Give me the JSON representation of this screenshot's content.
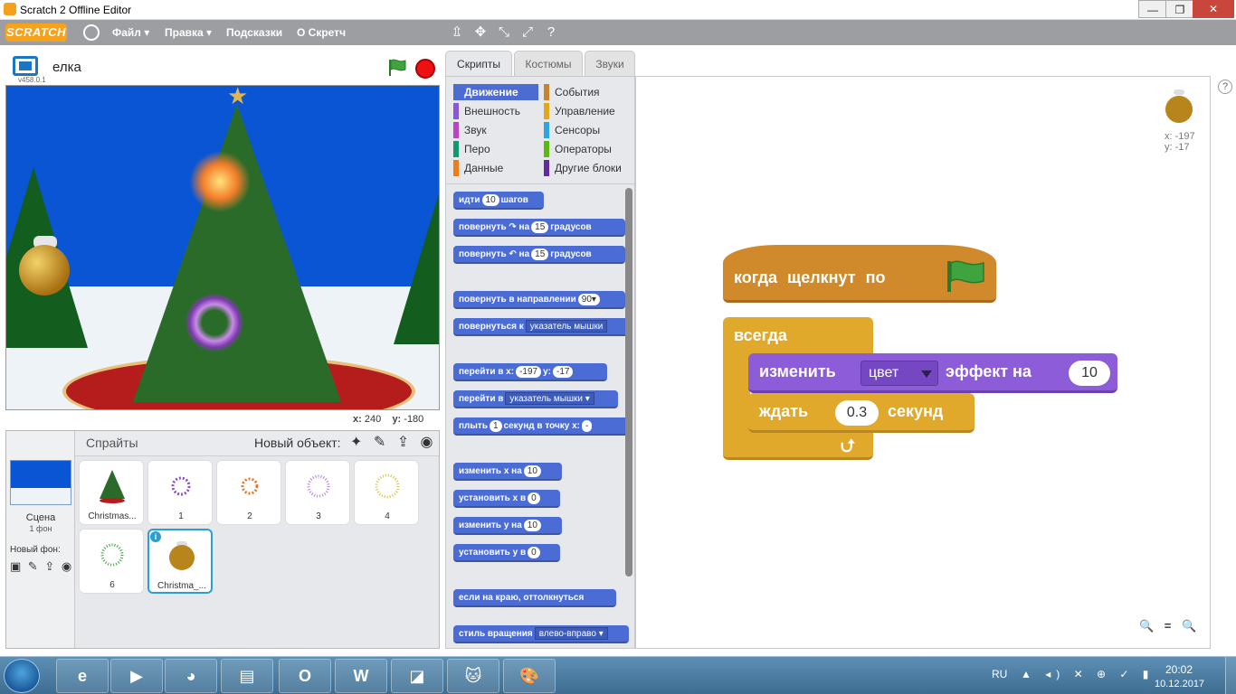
{
  "window": {
    "title": "Scratch 2 Offline Editor",
    "min": "—",
    "max": "❐",
    "close": "✕"
  },
  "menu": {
    "logo": "SCRATCH",
    "items": [
      "Файл ▾",
      "Правка ▾",
      "Подсказки",
      "О Скретч"
    ],
    "tools": [
      "⇫",
      "✥",
      "⤡",
      "⤢",
      "?"
    ]
  },
  "stage": {
    "project_name": "елка",
    "version": "v458.0.1",
    "mouse_x_label": "x:",
    "mouse_x": "240",
    "mouse_y_label": "y:",
    "mouse_y": "-180"
  },
  "sprites_panel": {
    "scene_label": "Сцена",
    "scene_sub": "1 фон",
    "new_backdrop_label": "Новый фон:",
    "new_backdrop_icons": "▣ ✎ ⇪ ◉",
    "title": "Спрайты",
    "new_object_label": "Новый объект:",
    "new_object_icons": "✦ ✎ ⇪ ◉",
    "sprites": [
      {
        "name": "Christmas..."
      },
      {
        "name": "1"
      },
      {
        "name": "2"
      },
      {
        "name": "3"
      },
      {
        "name": "4"
      },
      {
        "name": "6"
      },
      {
        "name": "Christma_..."
      }
    ],
    "info_badge": "i"
  },
  "tabs": [
    "Скрипты",
    "Костюмы",
    "Звуки"
  ],
  "categories": [
    {
      "label": "Движение",
      "color": "#4a6cd4"
    },
    {
      "label": "События",
      "color": "#c88330"
    },
    {
      "label": "Внешность",
      "color": "#8a55d7"
    },
    {
      "label": "Управление",
      "color": "#e1a91a"
    },
    {
      "label": "Звук",
      "color": "#bb42c3"
    },
    {
      "label": "Сенсоры",
      "color": "#2ca5e2"
    },
    {
      "label": "Перо",
      "color": "#0e9a6c"
    },
    {
      "label": "Операторы",
      "color": "#5cb712"
    },
    {
      "label": "Данные",
      "color": "#ee7d16"
    },
    {
      "label": "Другие блоки",
      "color": "#632d99"
    }
  ],
  "palette_blocks": {
    "move": {
      "pre": "идти",
      "num": "10",
      "post": "шагов"
    },
    "turn_right": {
      "pre": "повернуть ↷ на",
      "num": "15",
      "post": "градусов"
    },
    "turn_left": {
      "pre": "повернуть ↶ на",
      "num": "15",
      "post": "градусов"
    },
    "point_dir": {
      "pre": "повернуть в направлении",
      "dd": "90▾"
    },
    "point_towards": {
      "pre": "повернуться к",
      "dd": "указатель мышки"
    },
    "goto_xy": {
      "pre": "перейти в x:",
      "num1": "-197",
      "mid": "y:",
      "num2": "-17"
    },
    "goto": {
      "pre": "перейти в",
      "dd": "указатель мышки ▾"
    },
    "glide": {
      "pre": "плыть",
      "num1": "1",
      "mid": "секунд в точку x:",
      "num2": "-"
    },
    "change_x": {
      "pre": "изменить х на",
      "num": "10"
    },
    "set_x": {
      "pre": "установить х в",
      "num": "0"
    },
    "change_y": {
      "pre": "изменить у на",
      "num": "10"
    },
    "set_y": {
      "pre": "установить у в",
      "num": "0"
    },
    "bounce": {
      "pre": "если на краю, оттолкнуться"
    },
    "rotation_style": {
      "pre": "стиль вращения",
      "dd": "влево-вправо ▾"
    }
  },
  "script_area": {
    "sprite_x": "x: -197",
    "sprite_y": "y: -17",
    "help": "?",
    "zoom": "🔍 = 🔍"
  },
  "script": {
    "hat_text": "когда щелкнут по",
    "forever": "всегда",
    "change_effect_pre": "изменить",
    "change_effect_dd": "цвет",
    "change_effect_mid": "эффект на",
    "change_effect_num": "10",
    "wait_pre": "ждать",
    "wait_num": "0.3",
    "wait_post": "секунд",
    "loop_arrow": "⮍"
  },
  "taskbar": {
    "items": [
      "e",
      "▶",
      "◕",
      "▤",
      "O",
      "W",
      "◪",
      "🐱",
      "🎨"
    ],
    "lang": "RU",
    "tray": "▲ ◂) ✕ ⊕ ✓ ▮",
    "time": "20:02",
    "date": "10.12.2017"
  }
}
